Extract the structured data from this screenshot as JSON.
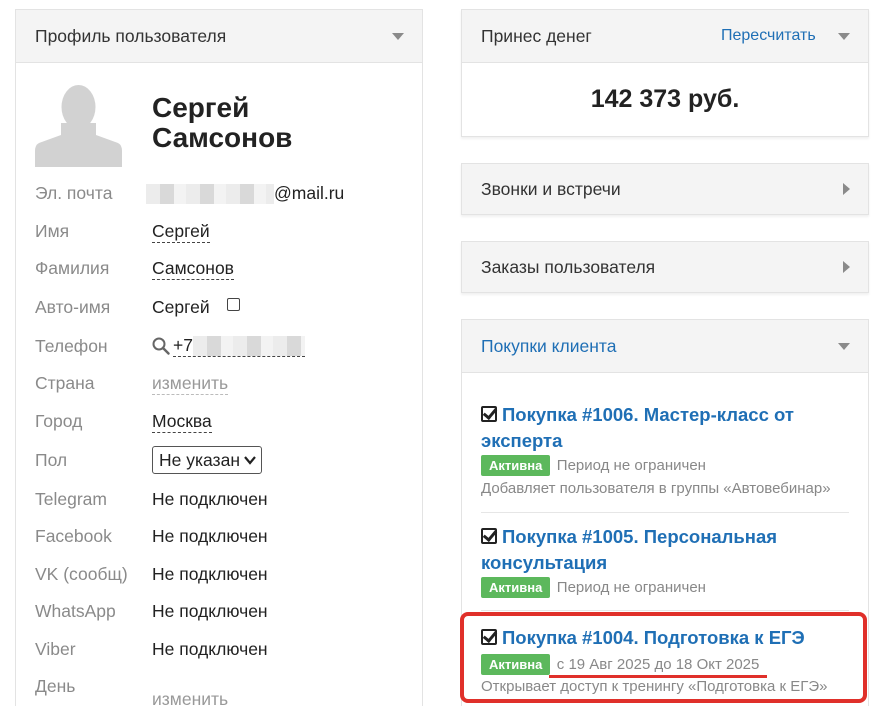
{
  "profile": {
    "header_title": "Профиль пользователя",
    "first_name_heading": "Сергей",
    "last_name_heading": "Самсонов",
    "fields": {
      "email_label": "Эл. почта",
      "email_suffix": "@mail.ru",
      "name_label": "Имя",
      "name_value": "Сергей",
      "surname_label": "Фамилия",
      "surname_value": "Самсонов",
      "autoname_label": "Авто-имя",
      "autoname_value": "Сергей",
      "phone_label": "Телефон",
      "phone_prefix": "+7",
      "country_label": "Страна",
      "country_value": "изменить",
      "city_label": "Город",
      "city_value": "Москва",
      "gender_label": "Пол",
      "gender_value": "Не указан",
      "telegram_label": "Telegram",
      "telegram_value": "Не подключен",
      "facebook_label": "Facebook",
      "facebook_value": "Не подключен",
      "vk_label": "VK (сообщ)",
      "vk_value": "Не подключен",
      "whatsapp_label": "WhatsApp",
      "whatsapp_value": "Не подключен",
      "viber_label": "Viber",
      "viber_value": "Не подключен",
      "day_label": "День",
      "day_value": "изменить"
    }
  },
  "money": {
    "header_title": "Принес денег",
    "recalc_link": "Пересчитать",
    "amount": "142 373 руб."
  },
  "calls": {
    "header_title": "Звонки и встречи"
  },
  "orders": {
    "header_title": "Заказы пользователя"
  },
  "purchases": {
    "header_title": "Покупки клиента",
    "items": [
      {
        "title_line1": "Покупка #1006. Мастер-класс от",
        "title_line2": "эксперта",
        "status": "Активна",
        "period": "Период не ограничен",
        "note": "Добавляет пользователя в группы «Автовебинар»"
      },
      {
        "title_line1": "Покупка #1005. Персональная",
        "title_line2": "консультация",
        "status": "Активна",
        "period": "Период не ограничен"
      },
      {
        "title_line1": "Покупка #1004. Подготовка к ЕГЭ",
        "status": "Активна",
        "period": "с 19 Авг 2025 до 18 Окт 2025",
        "note": "Открывает доступ к тренингу «Подготовка к ЕГЭ»"
      }
    ]
  },
  "colors": {
    "link": "#1f6fb5",
    "badge": "#5cb85c",
    "highlight": "#e0302a"
  }
}
